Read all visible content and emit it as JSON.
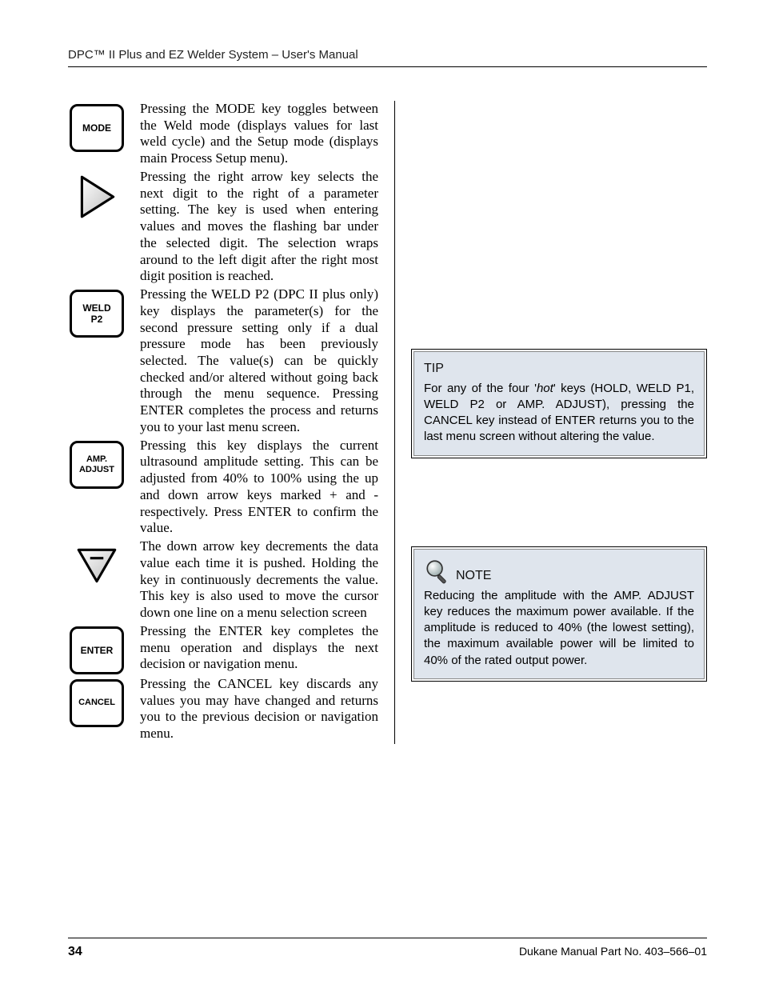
{
  "header": "DPC™ II Plus and EZ Welder System – User's Manual",
  "keys": {
    "mode": {
      "label": "MODE",
      "desc": "Pressing the MODE key toggles between the Weld mode (displays values for last weld cycle) and the Setup mode (displays main Process Setup menu)."
    },
    "right_arrow": {
      "desc": "Pressing the right arrow key selects the next digit to the right of a parameter setting. The key is used when entering values and moves the flashing bar under the selected digit. The selection wraps around to the left digit after the right most digit position is reached."
    },
    "weld_p2": {
      "label": "WELD\nP2",
      "desc": "Pressing the WELD P2 (DPC II plus only) key displays the parameter(s) for the second pressure setting only if a dual pressure mode has been previously selected. The value(s) can be quickly checked and/or altered without going back through the menu sequence. Pressing ENTER completes the process and returns you to your last menu screen."
    },
    "amp_adjust": {
      "label": "AMP.\nADJUST",
      "desc": "Pressing this key displays the current ultrasound amplitude setting. This can be adjusted from 40% to 100% using the up and down arrow keys marked + and - respectively. Press ENTER to confirm the value."
    },
    "down_arrow": {
      "desc": "The down arrow key decrements the data value each time it is pushed. Holding the key in continuously decrements the value. This key is also used to move the cursor down one line on a menu selection screen"
    },
    "enter": {
      "label": "ENTER",
      "desc": "Pressing the ENTER key completes the menu operation and displays the next decision or navigation menu."
    },
    "cancel": {
      "label": "CANCEL",
      "desc": "Pressing the CANCEL key discards any values you may have changed and returns you to the previous decision or navigation menu."
    }
  },
  "tip": {
    "title": "TIP",
    "body_pre": "For any of the four '",
    "body_hot": "hot",
    "body_post": "' keys (HOLD, WELD P1, WELD P2 or AMP. ADJUST), pressing the CANCEL key instead of ENTER returns you to the last menu screen without altering the value."
  },
  "note": {
    "title": "NOTE",
    "body": "Reducing the amplitude with the AMP. ADJUST key reduces the maximum power available. If the amplitude is reduced to 40% (the lowest setting), the maximum available power will be limited to 40% of the rated output power."
  },
  "footer": {
    "page": "34",
    "part": "Dukane Manual Part No. 403–566–01"
  }
}
